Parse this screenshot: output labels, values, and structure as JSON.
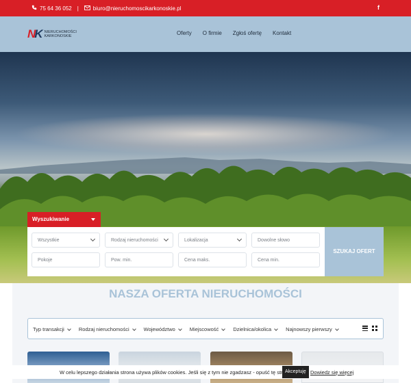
{
  "topbar": {
    "phone_icon": "phone-icon",
    "phone": "75 64 36 052",
    "separator": "|",
    "email_icon": "envelope-icon",
    "email": "biuro@nieruchomoscikarkonoskie.pl",
    "social_icon": "facebook-icon",
    "social_label": "f"
  },
  "header": {
    "logo_mark_n": "N",
    "logo_mark_k": "K",
    "logo_line1": "NIERUCHOMOŚCI",
    "logo_line2": "KARKONOSKIE",
    "nav": [
      "Oferty",
      "O firmie",
      "Zgłoś ofertę",
      "Kontakt"
    ]
  },
  "search": {
    "tab_label": "Wyszukiwanie",
    "row1": [
      {
        "label": "Wszystkie",
        "type": "select"
      },
      {
        "label": "Rodzaj nieruchomości",
        "type": "select"
      },
      {
        "label": "Lokalizacja",
        "type": "select"
      },
      {
        "label": "Dowolne słowo",
        "type": "input"
      }
    ],
    "row2": [
      "Pokoje",
      "Pow. min.",
      "Cena maks.",
      "Cena min."
    ],
    "button_label": "SZUKAJ OFERT"
  },
  "offers": {
    "title": "NASZA OFERTA NIERUCHOMOŚCI",
    "filters": [
      "Typ transakcji",
      "Rodzaj nieruchomości",
      "Województwo",
      "Miejscowość",
      "Dzielnica/okolica",
      "Najnowszy pierwszy"
    ]
  },
  "cookie": {
    "message": "W celu lepszego działania strona używa plików cookies. Jeśli się z tym nie zgadzasz - opuść tę stronę.",
    "accept_label": "Akceptuję",
    "more_label": "Dowiedz się więcej"
  },
  "colors": {
    "brand_red": "#d81f26",
    "header_blue": "#a9c3d8"
  }
}
